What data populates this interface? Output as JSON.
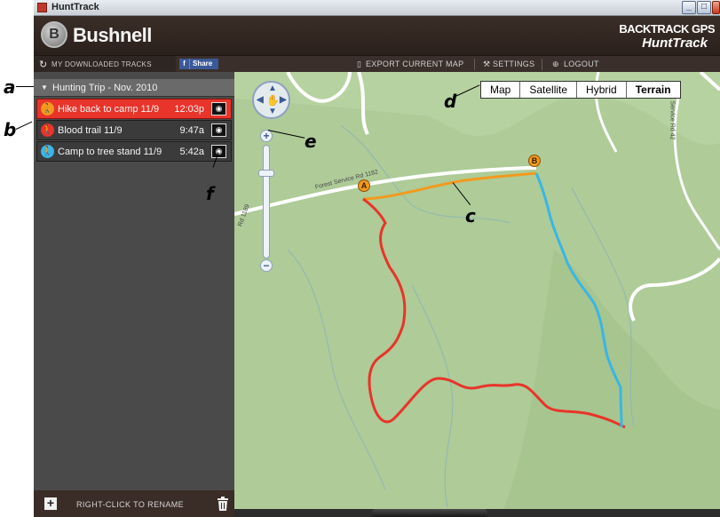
{
  "window": {
    "title": "HuntTrack",
    "minimize": "_",
    "maximize": "□",
    "close": "✕"
  },
  "header": {
    "logo_mark": "B",
    "logo_text": "Bushnell",
    "brand_line1": "BACKTRACK GPS",
    "brand_line2": "HuntTrack"
  },
  "tabs": {
    "downloaded_label": "MY DOWNLOADED TRACKS",
    "share_f": "f",
    "share_label": "Share",
    "export_label": "EXPORT CURRENT MAP",
    "settings_label": "SETTINGS",
    "logout_label": "LOGOUT"
  },
  "sidebar": {
    "trip_label": "Hunting Trip - Nov. 2010",
    "tracks": [
      {
        "name": "Hike back to camp 11/9",
        "time": "12:03p",
        "color": "#f29a1d",
        "selected": true
      },
      {
        "name": "Blood trail 11/9",
        "time": "9:47a",
        "color": "#e8342a",
        "selected": false
      },
      {
        "name": "Camp to tree stand 11/9",
        "time": "5:42a",
        "color": "#39b6e6",
        "selected": false
      }
    ],
    "footer_label": "RIGHT-CLICK TO RENAME"
  },
  "map": {
    "types": [
      "Map",
      "Satellite",
      "Hybrid",
      "Terrain"
    ],
    "active_type": "Terrain",
    "road_label_1": "Forest Service Rd 1182",
    "road_label_2": "Forest Service Rd 42",
    "road_label_3": "Rd 1189",
    "marker_a": "A",
    "marker_b": "B"
  },
  "callouts": {
    "a": "a",
    "b": "b",
    "c": "c",
    "d": "d",
    "e": "e",
    "f": "f"
  },
  "colors": {
    "blood_trail": "#e8342a",
    "hike_back": "#f29a1d",
    "camp_to_stand": "#39b6e6",
    "map_bg": "#aecb98"
  }
}
